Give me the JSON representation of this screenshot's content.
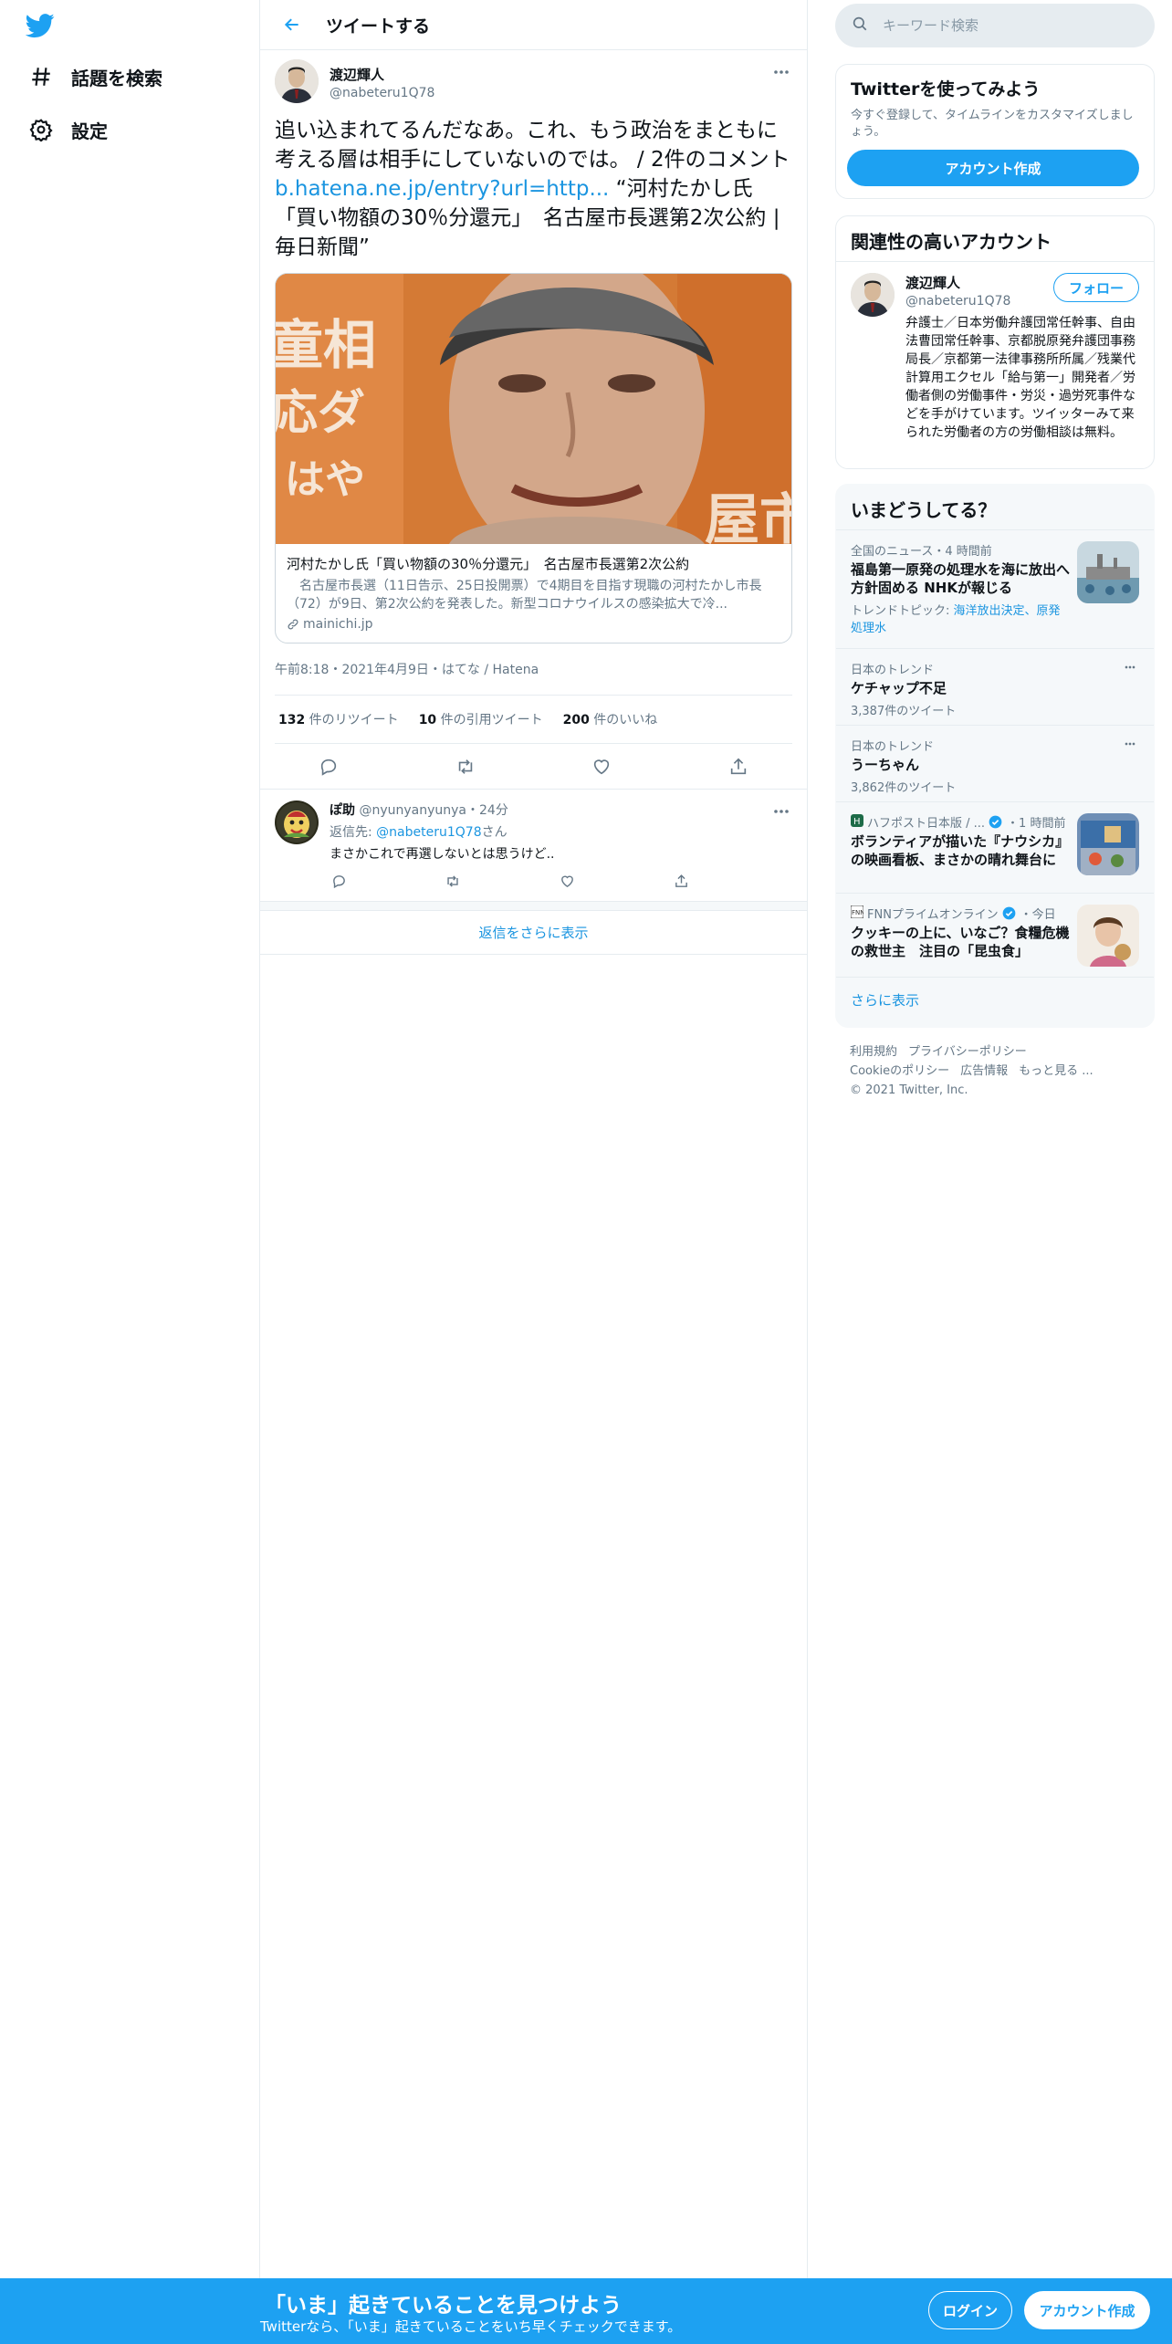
{
  "nav": {
    "items": [
      {
        "label": "話題を検索",
        "icon": "hashtag-icon"
      },
      {
        "label": "設定",
        "icon": "gear-icon"
      }
    ]
  },
  "header": {
    "title": "ツイートする"
  },
  "tweet": {
    "author_name": "渡辺輝人",
    "author_handle": "@nabeteru1Q78",
    "text_before": "追い込まれてるんだなあ。これ、もう政治をまともに考える層は相手にしていないのでは。 / 2件のコメント ",
    "link": "b.hatena.ne.jp/entry?url=http...",
    "text_after": " “河村たかし氏「買い物額の30％分還元」　名古屋市長選第2次公約 | 毎日新聞”",
    "card": {
      "title": "河村たかし氏「買い物額の30％分還元」　名古屋市長選第2次公約",
      "description": "　名古屋市長選（11日告示、25日投開票）で4期目を目指す現職の河村たかし市長（72）が9日、第2次公約を発表した。新型コロナウイルスの感染拡大で冷...",
      "domain": "mainichi.jp"
    },
    "meta": "午前8:18・2021年4月9日・はてな / Hatena",
    "stats": {
      "retweets_count": "132",
      "retweets_label": " 件のリツイート",
      "quotes_count": "10",
      "quotes_label": " 件の引用ツイート",
      "likes_count": "200",
      "likes_label": " 件のいいね"
    }
  },
  "reply": {
    "name": "ぽ助",
    "handle": "@nyunyanyunya",
    "time": "・24分",
    "reply_to_label": "返信先: ",
    "reply_to_handle": "@nabeteru1Q78",
    "reply_to_suffix": "さん",
    "text": "まさかこれで再選しないとは思うけど.."
  },
  "show_more_replies": "返信をさらに表示",
  "search": {
    "placeholder": "キーワード検索"
  },
  "signup_panel": {
    "title": "Twitterを使ってみよう",
    "description": "今すぐ登録して、タイムラインをカスタマイズしましょう。",
    "button": "アカウント作成"
  },
  "related_panel": {
    "title": "関連性の高いアカウント",
    "name": "渡辺輝人",
    "handle": "@nabeteru1Q78",
    "follow_label": "フォロー",
    "bio": "弁護士／日本労働弁護団常任幹事、自由法曹団常任幹事、京都脱原発弁護団事務局長／京都第一法律事務所所属／残業代計算用エクセル「給与第一」開発者／労働者側の労働事件・労災・過労死事件などを手がけています。ツイッターみて来られた労働者の方の労働相談は無料。"
  },
  "trends_panel": {
    "title": "いまどうしてる？",
    "items": [
      {
        "meta": "全国のニュース・4 時間前",
        "title": "福島第一原発の処理水を海に放出へ方針固める NHKが報じる",
        "sub_label": "トレンドトピック: ",
        "sub_links": "海洋放出決定、原発処理水"
      },
      {
        "meta": "日本のトレンド",
        "title": "ケチャップ不足",
        "sub": "3,387件のツイート"
      },
      {
        "meta": "日本のトレンド",
        "title": "うーちゃん",
        "sub": "3,862件のツイート"
      },
      {
        "source": "ハフポスト日本版 / ...",
        "time": "・1 時間前",
        "title": "ボランティアが描いた『ナウシカ』の映画看板、まさかの晴れ舞台に"
      },
      {
        "source": "FNNプライムオンライン",
        "time": "・今日",
        "title": "クッキーの上に、いなご？食糧危機の救世主　注目の「昆虫食」"
      }
    ],
    "show_more": "さらに表示"
  },
  "footer": {
    "links": [
      "利用規約",
      "プライバシーポリシー",
      "Cookieのポリシー",
      "広告情報",
      "もっと見る ..."
    ],
    "copyright": "© 2021 Twitter, Inc."
  },
  "bottom_bar": {
    "title": "「いま」起きていることを見つけよう",
    "subtitle": "Twitterなら、「いま」起きていることをいち早くチェックできます。",
    "login": "ログイン",
    "signup": "アカウント作成"
  },
  "colors": {
    "accent": "#1da1f2",
    "link": "#1b95e0",
    "muted": "#657786",
    "border": "#e6ecf0"
  }
}
